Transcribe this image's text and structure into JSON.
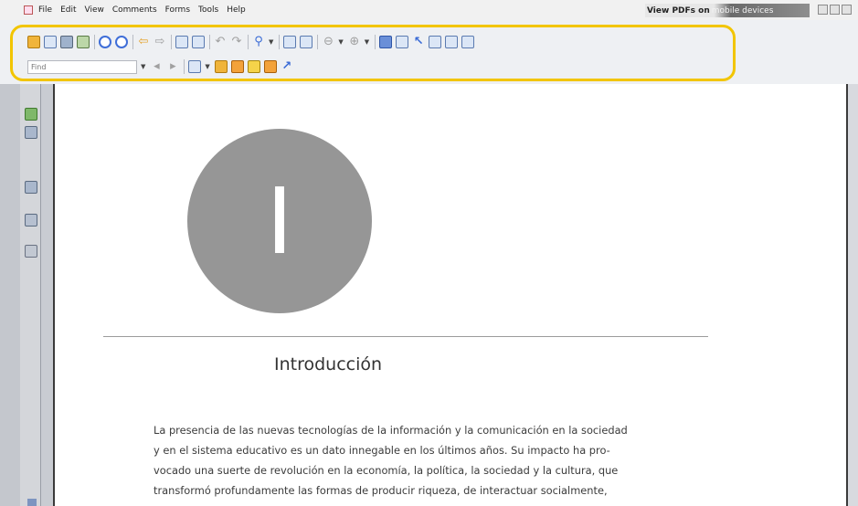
{
  "menubar": {
    "items": [
      "File",
      "Edit",
      "View",
      "Comments",
      "Forms",
      "Tools",
      "Help"
    ],
    "banner_dark": "View PDFs on",
    "banner_light": "mobile devices"
  },
  "toolbar": {
    "find_placeholder": "Find",
    "highlight_color": "#f2c500"
  },
  "document": {
    "chapter_number": "I",
    "heading": "Introducción",
    "paragraph_lines": [
      "La presencia de las nuevas tecnologías de la información y la comunicación en la sociedad",
      "y en el sistema educativo es un dato innegable en los últimos años. Su impacto ha pro-",
      "vocado una suerte de revolución en la economía, la política, la sociedad y la cultura, que",
      "transformó profundamente las formas de producir riqueza, de interactuar socialmente,"
    ]
  }
}
